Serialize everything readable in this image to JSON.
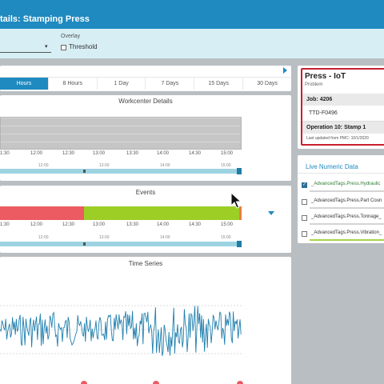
{
  "header": {
    "title": "tails: Stamping Press"
  },
  "controls": {
    "overlay_label": "Overlay",
    "threshold_label": "Threshold",
    "select_arrow": "▾"
  },
  "range_tabs": [
    "Hours",
    "8 Hours",
    "1 Day",
    "7 Days",
    "15 Days",
    "30 Days"
  ],
  "active_tab": 0,
  "workcenter": {
    "title": "Workcenter Details",
    "axis": [
      "1:30",
      "12:00",
      "12:30",
      "13:00",
      "13:30",
      "14:00",
      "14:30",
      "15:00"
    ],
    "nav_axis": [
      "12:00",
      "13:00",
      "14:00",
      "15:00"
    ]
  },
  "events": {
    "title": "Events",
    "axis": [
      "1:30",
      "12:00",
      "12:30",
      "13:00",
      "13:30",
      "14:00",
      "14:30",
      "15:00"
    ],
    "nav_axis": [
      "12:00",
      "13:00",
      "14:00",
      "15:00"
    ],
    "segments": [
      {
        "state": "red",
        "color": "#ec5a62"
      },
      {
        "state": "green",
        "color": "#9dce26"
      },
      {
        "state": "orange",
        "color": "#ec7d3e"
      }
    ]
  },
  "time_series": {
    "title": "Time Series",
    "line_color": "#1f7fae"
  },
  "press": {
    "title": "Press - IoT",
    "status": "Problem",
    "job": "Job: 4206",
    "part": "TTD-F0496",
    "operation": "Operation 10: Stamp 1",
    "updated": "Last updated from PMC: 10/1/2020",
    "border_color": "#c8202f"
  },
  "live": {
    "title": "Live Numeric Data",
    "tags": [
      {
        "name": "_AdvancedTags.Press.Hydraulic",
        "checked": true
      },
      {
        "name": "_AdvancedTags.Press.Part Coun",
        "checked": false
      },
      {
        "name": "_AdvancedTags.Press.Tonnage_",
        "checked": false
      },
      {
        "name": "_AdvancedTags.Press.Vibration_",
        "checked": false
      }
    ]
  },
  "colors": {
    "accent": "#1f8ac0",
    "header": "#1f8ac0",
    "control_bar": "#d6eef4"
  }
}
